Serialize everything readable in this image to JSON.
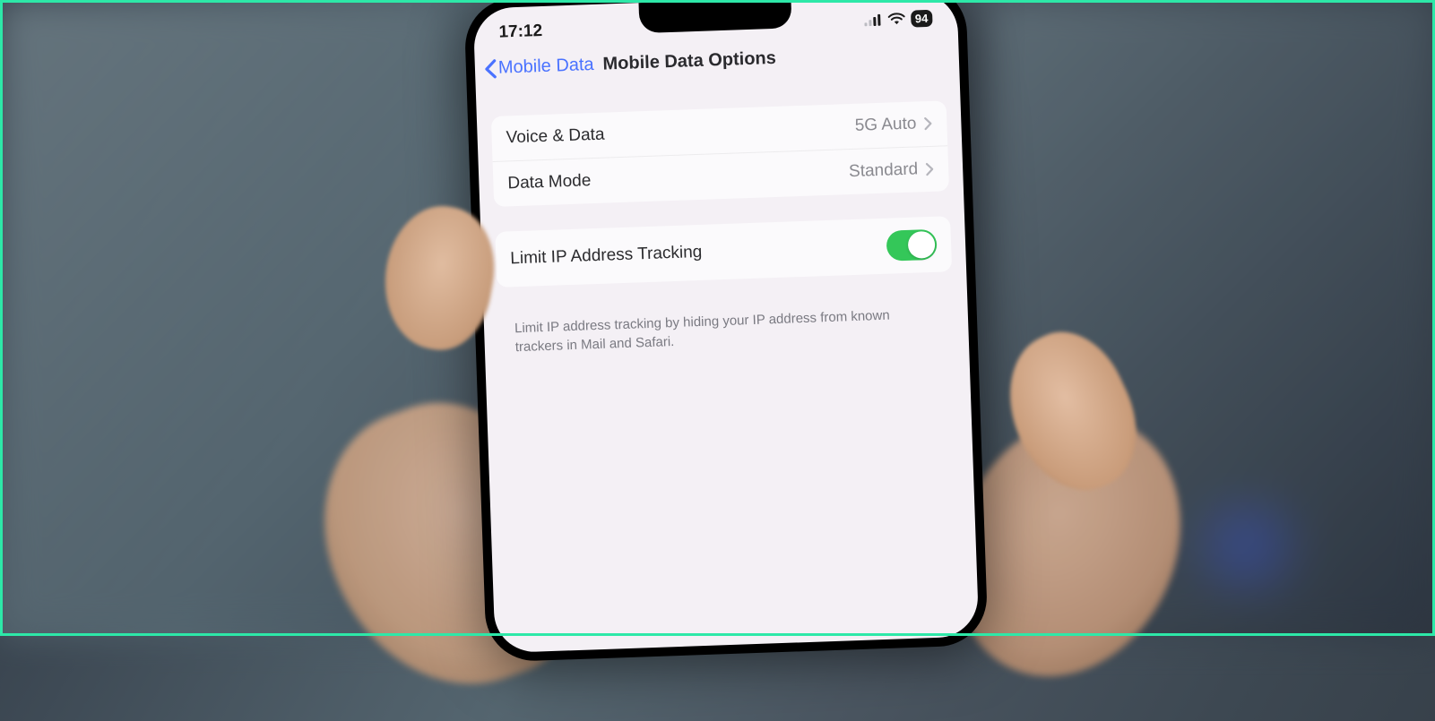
{
  "status": {
    "time": "17:12",
    "battery": "94"
  },
  "nav": {
    "back_label": "Mobile Data",
    "title": "Mobile Data Options"
  },
  "rows": {
    "voice_data": {
      "label": "Voice & Data",
      "value": "5G Auto"
    },
    "data_mode": {
      "label": "Data Mode",
      "value": "Standard"
    },
    "limit_ip": {
      "label": "Limit IP Address Tracking",
      "on": true
    }
  },
  "footer": "Limit IP address tracking by hiding your IP address from known trackers in Mail and Safari."
}
